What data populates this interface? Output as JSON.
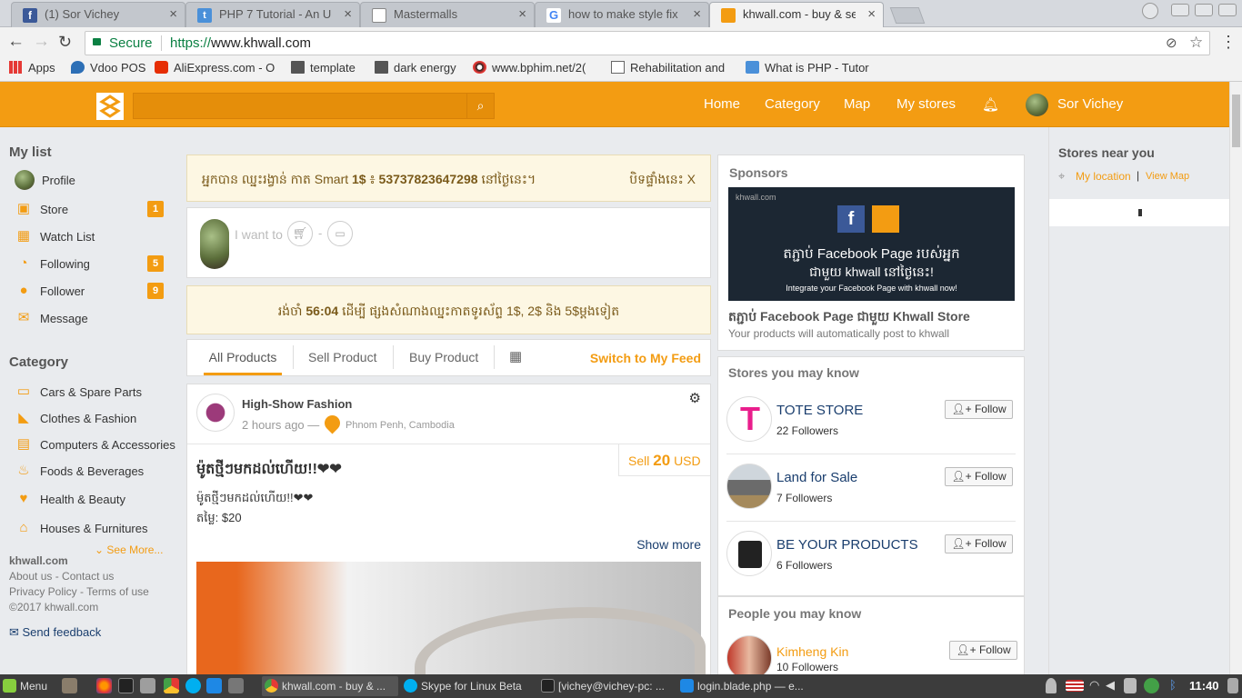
{
  "browser": {
    "tabs": [
      {
        "title": "(1) Sor Vichey",
        "favicon": "facebook-favicon",
        "color": "#3b5998"
      },
      {
        "title": "PHP 7 Tutorial - An Ult",
        "favicon": "tutorial-favicon",
        "color": "#4a90d9"
      },
      {
        "title": "Mastermalls",
        "favicon": "page-favicon",
        "color": "#888888"
      },
      {
        "title": "how to make style fix",
        "favicon": "google-favicon",
        "color": "#4285f4"
      },
      {
        "title": "khwall.com - buy & se",
        "favicon": "khwall-favicon",
        "color": "#f39c12"
      }
    ],
    "close_glyph": "×",
    "secure_label": "Secure",
    "url_scheme": "https://",
    "url_host": "www.khwall.com",
    "bookmarks": [
      {
        "label": "Apps",
        "icon": "apps-grid-icon"
      },
      {
        "label": "Vdoo POS",
        "icon": "vdoo-icon"
      },
      {
        "label": "AliExpress.com - O",
        "icon": "aliexpress-icon"
      },
      {
        "label": "template",
        "icon": "folder-icon"
      },
      {
        "label": "dark energy",
        "icon": "folder-icon"
      },
      {
        "label": "www.bphim.net/2(",
        "icon": "bphim-icon"
      },
      {
        "label": "Rehabilitation and",
        "icon": "page-icon"
      },
      {
        "label": "What is PHP - Tutor",
        "icon": "tutorial-icon"
      }
    ]
  },
  "header": {
    "nav": [
      "Home",
      "Category",
      "Map",
      "My stores"
    ],
    "user_name": "Sor Vichey",
    "brand_color": "#f39c12"
  },
  "sidebar": {
    "my_list_title": "My list",
    "items": [
      {
        "label": "Profile",
        "icon": "profile-avatar-icon",
        "badge": ""
      },
      {
        "label": "Store",
        "icon": "store-icon",
        "badge": "1"
      },
      {
        "label": "Watch List",
        "icon": "calendar-icon",
        "badge": ""
      },
      {
        "label": "Following",
        "icon": "rss-icon",
        "badge": "5"
      },
      {
        "label": "Follower",
        "icon": "users-icon",
        "badge": "9"
      },
      {
        "label": "Message",
        "icon": "envelope-icon",
        "badge": ""
      }
    ],
    "category_title": "Category",
    "categories": [
      {
        "label": "Cars & Spare Parts",
        "icon": "car-icon"
      },
      {
        "label": "Clothes & Fashion",
        "icon": "boot-icon"
      },
      {
        "label": "Computers & Accessories",
        "icon": "computer-icon"
      },
      {
        "label": "Foods & Beverages",
        "icon": "food-icon"
      },
      {
        "label": "Health & Beauty",
        "icon": "heart-icon"
      },
      {
        "label": "Houses & Furnitures",
        "icon": "house-icon"
      }
    ],
    "see_more": "See More...",
    "site": "khwall.com",
    "about": "About us",
    "contact": "Contact us",
    "privacy": "Privacy Policy",
    "terms": "Terms of use",
    "copyright": "©2017 khwall.com",
    "feedback": "Send feedback"
  },
  "feed": {
    "winner_notice": {
      "prefix": "អ្នកបាន ឈ្នះរង្វាន់ កាត Smart",
      "amount": "1$",
      "mid": "៖",
      "number": "53737823647298",
      "suffix": "នៅថ្ងៃនេះ។",
      "close_label": "បិទផ្ទាំងនេះ X"
    },
    "composer_placeholder": "I want to",
    "composer_dash": "-",
    "countdown_notice": {
      "prefix": "រង់ចាំ",
      "time": "56:04",
      "suffix": "ដើម្បី ផ្សងសំណាងឈ្នះកាតទូរស័ព្ទ 1$, 2$ និង 5$ម្តងទៀត"
    },
    "tabs": [
      "All Products",
      "Sell Product",
      "Buy Product"
    ],
    "switch_feed": "Switch to My Feed",
    "post": {
      "store": "High-Show Fashion",
      "time": "2 hours ago —",
      "location": "Phnom Penh, Cambodia",
      "sell_label": "Sell",
      "price": "20",
      "currency": "USD",
      "title": "ម៉ូតថ្មីៗមកដល់ហើយ!!❤❤",
      "body_line1": "ម៉ូតថ្មីៗមកដល់ហើយ!!❤❤",
      "body_line2": "តម្លៃ: $20",
      "show_more": "Show more"
    }
  },
  "right": {
    "sponsors_title": "Sponsors",
    "banner_line1": "តភ្ជាប់ Facebook Page របស់អ្នក",
    "banner_line2": "ជាមួយ khwall នៅថ្ងៃនេះ!",
    "banner_line3": "Integrate your Facebook Page with khwall now!",
    "banner_brand": "khwall.com",
    "sponsor_title": "តភ្ជាប់ Facebook Page ជាមួយ Khwall Store",
    "sponsor_sub": "Your products will automatically post to khwall",
    "stores_title": "Stores you may know",
    "stores": [
      {
        "name": "TOTE STORE",
        "followers": "22 Followers",
        "color": "#1a3e6e"
      },
      {
        "name": "Land for Sale",
        "followers": "7 Followers",
        "color": "#1a3e6e"
      },
      {
        "name": "BE YOUR PRODUCTS",
        "followers": "6 Followers",
        "color": "#1a3e6e"
      }
    ],
    "follow_label": "Follow",
    "people_title": "People you may know",
    "people": [
      {
        "name": "Kimheng Kin",
        "followers": "10 Followers"
      }
    ]
  },
  "far_right": {
    "title": "Stores near you",
    "my_location": "My location",
    "divider": "|",
    "view_map": "View Map"
  },
  "taskbar": {
    "menu": "Menu",
    "windows": [
      {
        "label": "khwall.com - buy & ...",
        "icon": "chrome-icon"
      },
      {
        "label": "Skype for Linux Beta",
        "icon": "skype-icon"
      },
      {
        "label": "[vichey@vichey-pc: ...",
        "icon": "terminal-icon"
      },
      {
        "label": "login.blade.php — e...",
        "icon": "vscode-icon"
      }
    ],
    "clock": "11:40"
  }
}
